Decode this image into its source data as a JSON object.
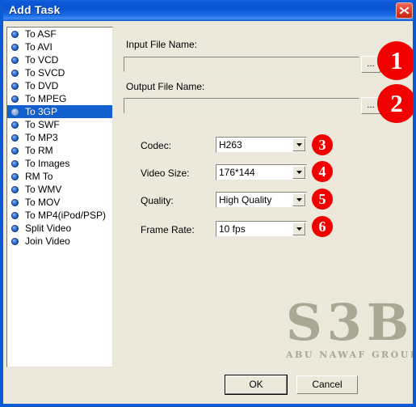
{
  "window": {
    "title": "Add Task",
    "close_icon": "close-icon"
  },
  "sidebar": {
    "items": [
      {
        "label": "To ASF",
        "selected": false
      },
      {
        "label": "To AVI",
        "selected": false
      },
      {
        "label": "To VCD",
        "selected": false
      },
      {
        "label": "To SVCD",
        "selected": false
      },
      {
        "label": "To DVD",
        "selected": false
      },
      {
        "label": "To MPEG",
        "selected": false
      },
      {
        "label": "To 3GP",
        "selected": true
      },
      {
        "label": "To SWF",
        "selected": false
      },
      {
        "label": "To MP3",
        "selected": false
      },
      {
        "label": "To RM",
        "selected": false
      },
      {
        "label": "To Images",
        "selected": false
      },
      {
        "label": "RM To",
        "selected": false
      },
      {
        "label": "To WMV",
        "selected": false
      },
      {
        "label": "To MOV",
        "selected": false
      },
      {
        "label": "To MP4(iPod/PSP)",
        "selected": false
      },
      {
        "label": "Split Video",
        "selected": false
      },
      {
        "label": "Join Video",
        "selected": false
      }
    ]
  },
  "form": {
    "input_file": {
      "label": "Input File Name:",
      "value": "",
      "placeholder": "",
      "browse_label": "..."
    },
    "output_file": {
      "label": "Output File Name:",
      "value": "",
      "placeholder": "",
      "browse_label": "..."
    },
    "codec": {
      "label": "Codec:",
      "value": "H263"
    },
    "video_size": {
      "label": "Video Size:",
      "value": "176*144"
    },
    "quality": {
      "label": "Quality:",
      "value": "High Quality"
    },
    "frame_rate": {
      "label": "Frame Rate:",
      "value": "10 fps"
    }
  },
  "badges": {
    "one": "1",
    "two": "2",
    "three": "3",
    "four": "4",
    "five": "5",
    "six": "6"
  },
  "watermark": {
    "main": "S3B",
    "sub": "ABU NAWAF GROUP"
  },
  "buttons": {
    "ok": "OK",
    "cancel": "Cancel"
  },
  "colors": {
    "titlebar_blue": "#0a54d2",
    "selection_blue": "#1260cd",
    "badge_red": "#f20000",
    "dialog_background": "#ece9dc",
    "watermark_gray": "#a8a894"
  }
}
